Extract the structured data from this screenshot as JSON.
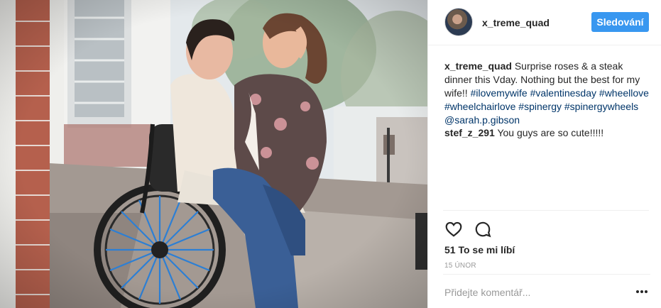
{
  "post": {
    "photo_icon": "post-photo",
    "author": {
      "username": "x_treme_quad",
      "avatar_icon": "profile-avatar"
    },
    "follow_label": "Sledování",
    "caption": {
      "username": "x_treme_quad",
      "text": " Surprise roses & a steak dinner this Vday. Nothing but the best for my wife!! ",
      "tags": [
        "#ilovemywife",
        "#valentinesday",
        "#wheellove",
        "#wheelchairlove",
        "#spinergy",
        "#spinergywheels"
      ],
      "mention": "@sarah.p.gibson"
    },
    "comments": [
      {
        "username": "stef_z_291",
        "text": " You guys are so cute!!!!!"
      }
    ],
    "actions": {
      "like_icon": "heart-icon",
      "comment_icon": "comment-icon"
    },
    "likes_text": "51 To se mi líbí",
    "date": "15 ÚNOR",
    "comment_placeholder": "Přidejte komentář...",
    "more_icon": "ellipsis-icon",
    "colors": {
      "follow_button": "#3897f0",
      "hashtag": "#003569",
      "muted": "#999999"
    }
  }
}
